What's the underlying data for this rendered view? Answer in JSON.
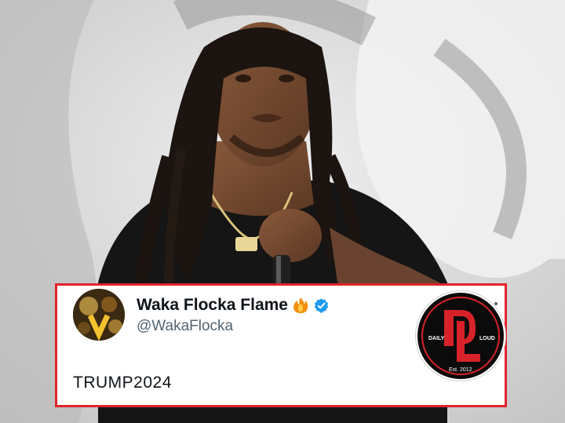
{
  "tweet": {
    "display_name": "Waka Flocka Flame",
    "handle": "@WakaFlocka",
    "text": "TRUMP2024",
    "name_emoji_icon": "fire-icon",
    "badge_icon": "verified-badge-icon",
    "menu_icon": "more-options-icon"
  },
  "watermark": {
    "icon": "daily-loud-logo",
    "logo_lettering": [
      "DL",
      "DAILY",
      "LOUD",
      "Est. 2012"
    ]
  },
  "colors": {
    "card_border": "#e0242a",
    "name_text": "#0f1419",
    "handle_text": "#536471",
    "verified": "#1d9bf0",
    "logo_red": "#d8222a"
  }
}
